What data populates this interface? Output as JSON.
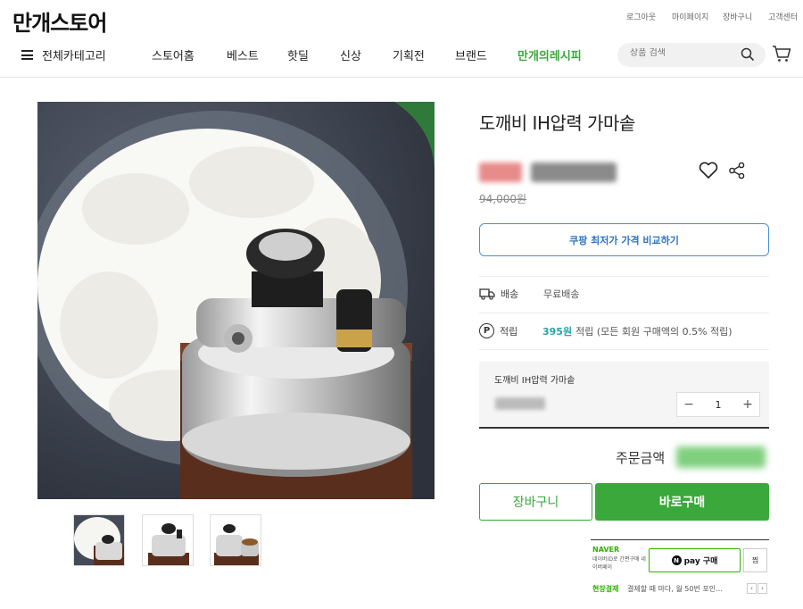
{
  "header": {
    "logo": "만개스토어",
    "util_links": [
      "로그아웃",
      "마이페이지",
      "장바구니",
      "고객센터"
    ],
    "all_categories": "전체카테고리",
    "nav": [
      "스토어홈",
      "베스트",
      "핫딜",
      "신상",
      "기획전",
      "브랜드",
      "만개의레시피"
    ],
    "search_placeholder": "상품 검색"
  },
  "product": {
    "title": "도깨비 IH압력 가마솥",
    "original_price": "94,000원",
    "compare_button": "쿠팡 최저가 가격 비교하기",
    "shipping_label": "배송",
    "shipping_value": "무료배송",
    "points_label": "적립",
    "points_amount": "395원",
    "points_desc": "적립 (모든 회원 구매액의 0.5% 적립)",
    "point_icon_letter": "P"
  },
  "option": {
    "name": "도깨비 IH압력 가마솥",
    "quantity": "1",
    "minus": "−",
    "plus": "+"
  },
  "order": {
    "total_label": "주문금액",
    "cart_button": "장바구니",
    "buy_button": "바로구매"
  },
  "naver": {
    "logo": "NAVER",
    "desc": "네이버ID로 간편구매 네이버페이",
    "npay_n": "N",
    "npay_label": "pay 구매",
    "zzim": "찜",
    "onsite_label": "현장결제",
    "onsite_desc": "결제할 때 마다, 월 50번 포인…",
    "prev": "‹",
    "next": "›"
  },
  "colors": {
    "brand_green": "#3aa83a",
    "compare_blue": "#4a90d9",
    "points_teal": "#2aa3a3",
    "naver_green": "#2db400"
  }
}
